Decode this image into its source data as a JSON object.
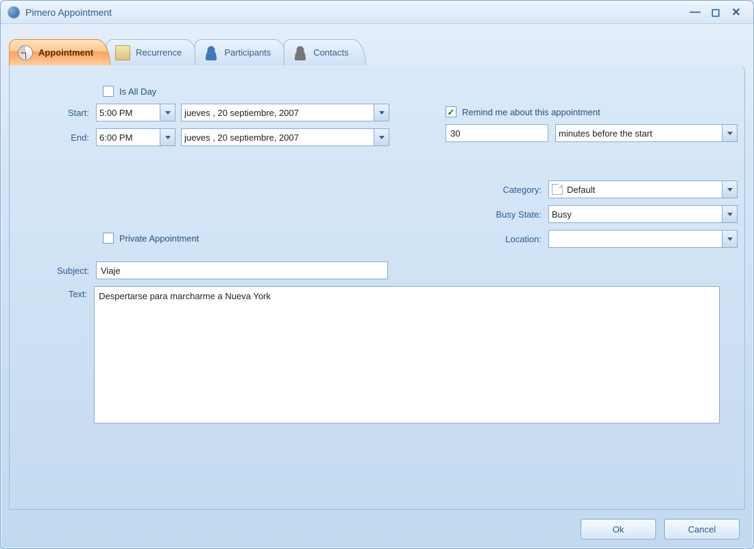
{
  "window": {
    "title": "Pimero Appointment"
  },
  "tabs": {
    "appointment": "Appointment",
    "recurrence": "Recurrence",
    "participants": "Participants",
    "contacts": "Contacts"
  },
  "form": {
    "is_all_day_label": "Is All Day",
    "is_all_day_checked": false,
    "start_label": "Start:",
    "start_time": "5:00 PM",
    "start_date": "jueves  , 20 septiembre, 2007",
    "end_label": "End:",
    "end_time": "6:00 PM",
    "end_date": "jueves  , 20 septiembre, 2007",
    "remind_checked": true,
    "remind_label": "Remind me about this appointment",
    "remind_value": "30",
    "remind_unit": "minutes before the start",
    "category_label": "Category:",
    "category_value": "Default",
    "busy_label": "Busy State:",
    "busy_value": "Busy",
    "location_label": "Location:",
    "location_value": "",
    "private_label": "Private Appointment",
    "private_checked": false,
    "subject_label": "Subject:",
    "subject_value": "Viaje",
    "text_label": "Text:",
    "text_value": "Despertarse para marcharme a Nueva York"
  },
  "buttons": {
    "ok": "Ok",
    "cancel": "Cancel"
  }
}
